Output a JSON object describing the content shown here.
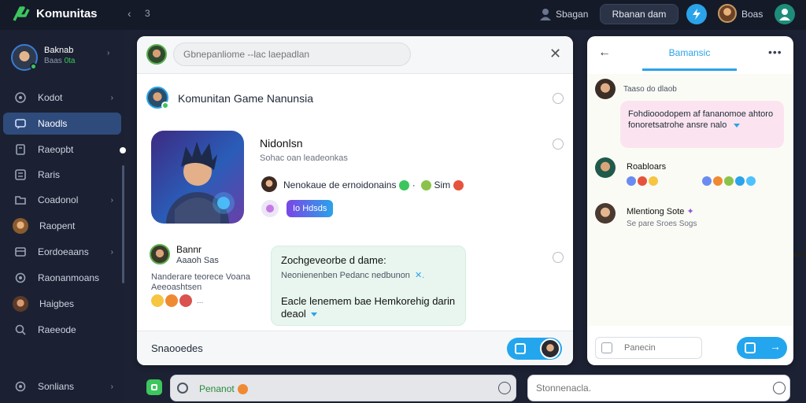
{
  "header": {
    "brand": "Komunitas",
    "back": "‹",
    "page_number": "3",
    "user_label": "Sbagan",
    "action_button": "Rbanan dam",
    "profile_name": "Boas"
  },
  "sidebar": {
    "profile": {
      "name": "Baknab",
      "status_text": "Baas",
      "status_value": "0ta"
    },
    "items": [
      {
        "label": "Kodot",
        "icon": "gamepad-icon",
        "chevron": true,
        "active": false
      },
      {
        "label": "Naodls",
        "icon": "chat-icon",
        "chevron": false,
        "active": true
      },
      {
        "label": "Raeopbt",
        "icon": "bookmark-icon",
        "chevron": false,
        "active": false
      },
      {
        "label": "Raris",
        "icon": "people-icon",
        "chevron": false,
        "active": false
      },
      {
        "label": "Coadonol",
        "icon": "folder-icon",
        "chevron": true,
        "active": false
      },
      {
        "label": "Raopent",
        "icon": "avatar-icon",
        "chevron": false,
        "active": false
      },
      {
        "label": "Eordoeaans",
        "icon": "grid-icon",
        "chevron": true,
        "active": false
      },
      {
        "label": "Raonanmoans",
        "icon": "settings-icon",
        "chevron": false,
        "active": false
      },
      {
        "label": "Haigbes",
        "icon": "avatar-icon",
        "chevron": false,
        "active": false
      },
      {
        "label": "Raeeode",
        "icon": "search-icon",
        "chevron": false,
        "active": false
      }
    ],
    "footer": {
      "label": "Sonlians"
    }
  },
  "feed": {
    "search_placeholder": "Gbnepanliome --lac laepadlan",
    "group_title": "Komunitan Game Nanunsia",
    "game": {
      "title": "Nidonlsn",
      "subtitle": "Sohac oan leadeonkas",
      "description": "Nenokaue de ernoidonains",
      "description_tail": "Sim",
      "tag": "Io Hdsds"
    },
    "post": {
      "author": "Bannr",
      "meta": "Aaaoh  Sas",
      "text": "Nanderare teorece Voana Aeeoashtsen",
      "reactions_more": "..."
    },
    "bubble": {
      "line1": "Zochgeveorbe d dame:",
      "line2": "Neonienenben Pedanc nedbunon",
      "line3": "Eacle lenemem bae Hemkorehig darin",
      "line4": "deaol"
    },
    "footer_label": "Snaooedes"
  },
  "chat": {
    "back": "←",
    "tab": "Bamansic",
    "more": "•••",
    "msg1_name": "Taaso do dlaob",
    "msg1_text": "Fohdiooodopem af fananomoe ahtoro fonoretsatrohe ansre nalo",
    "msg2_name": "Roabloars",
    "msg3_name": "Mlentiong Sote",
    "msg3_text": "Se pare Sroes Sogs",
    "input_placeholder": "Panecin"
  },
  "bottom": {
    "search_text": "Penanot",
    "input_placeholder": "Stonnenacla."
  },
  "colors": {
    "accent": "#2aa3ea",
    "online": "#3cc65d",
    "sidebar_bg": "#1b2132",
    "active_item": "#2f4b7c",
    "bubble": "#e8f6ef",
    "pink_bubble": "#fbe4ef"
  }
}
